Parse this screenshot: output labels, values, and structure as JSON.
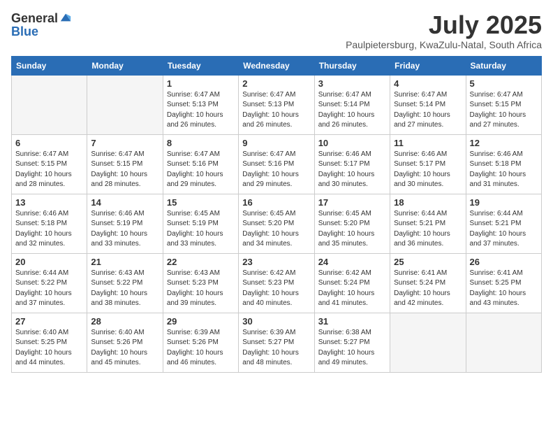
{
  "logo": {
    "general": "General",
    "blue": "Blue"
  },
  "title": "July 2025",
  "location": "Paulpietersburg, KwaZulu-Natal, South Africa",
  "weekdays": [
    "Sunday",
    "Monday",
    "Tuesday",
    "Wednesday",
    "Thursday",
    "Friday",
    "Saturday"
  ],
  "weeks": [
    [
      {
        "day": "",
        "info": ""
      },
      {
        "day": "",
        "info": ""
      },
      {
        "day": "1",
        "info": "Sunrise: 6:47 AM\nSunset: 5:13 PM\nDaylight: 10 hours and 26 minutes."
      },
      {
        "day": "2",
        "info": "Sunrise: 6:47 AM\nSunset: 5:13 PM\nDaylight: 10 hours and 26 minutes."
      },
      {
        "day": "3",
        "info": "Sunrise: 6:47 AM\nSunset: 5:14 PM\nDaylight: 10 hours and 26 minutes."
      },
      {
        "day": "4",
        "info": "Sunrise: 6:47 AM\nSunset: 5:14 PM\nDaylight: 10 hours and 27 minutes."
      },
      {
        "day": "5",
        "info": "Sunrise: 6:47 AM\nSunset: 5:15 PM\nDaylight: 10 hours and 27 minutes."
      }
    ],
    [
      {
        "day": "6",
        "info": "Sunrise: 6:47 AM\nSunset: 5:15 PM\nDaylight: 10 hours and 28 minutes."
      },
      {
        "day": "7",
        "info": "Sunrise: 6:47 AM\nSunset: 5:15 PM\nDaylight: 10 hours and 28 minutes."
      },
      {
        "day": "8",
        "info": "Sunrise: 6:47 AM\nSunset: 5:16 PM\nDaylight: 10 hours and 29 minutes."
      },
      {
        "day": "9",
        "info": "Sunrise: 6:47 AM\nSunset: 5:16 PM\nDaylight: 10 hours and 29 minutes."
      },
      {
        "day": "10",
        "info": "Sunrise: 6:46 AM\nSunset: 5:17 PM\nDaylight: 10 hours and 30 minutes."
      },
      {
        "day": "11",
        "info": "Sunrise: 6:46 AM\nSunset: 5:17 PM\nDaylight: 10 hours and 30 minutes."
      },
      {
        "day": "12",
        "info": "Sunrise: 6:46 AM\nSunset: 5:18 PM\nDaylight: 10 hours and 31 minutes."
      }
    ],
    [
      {
        "day": "13",
        "info": "Sunrise: 6:46 AM\nSunset: 5:18 PM\nDaylight: 10 hours and 32 minutes."
      },
      {
        "day": "14",
        "info": "Sunrise: 6:46 AM\nSunset: 5:19 PM\nDaylight: 10 hours and 33 minutes."
      },
      {
        "day": "15",
        "info": "Sunrise: 6:45 AM\nSunset: 5:19 PM\nDaylight: 10 hours and 33 minutes."
      },
      {
        "day": "16",
        "info": "Sunrise: 6:45 AM\nSunset: 5:20 PM\nDaylight: 10 hours and 34 minutes."
      },
      {
        "day": "17",
        "info": "Sunrise: 6:45 AM\nSunset: 5:20 PM\nDaylight: 10 hours and 35 minutes."
      },
      {
        "day": "18",
        "info": "Sunrise: 6:44 AM\nSunset: 5:21 PM\nDaylight: 10 hours and 36 minutes."
      },
      {
        "day": "19",
        "info": "Sunrise: 6:44 AM\nSunset: 5:21 PM\nDaylight: 10 hours and 37 minutes."
      }
    ],
    [
      {
        "day": "20",
        "info": "Sunrise: 6:44 AM\nSunset: 5:22 PM\nDaylight: 10 hours and 37 minutes."
      },
      {
        "day": "21",
        "info": "Sunrise: 6:43 AM\nSunset: 5:22 PM\nDaylight: 10 hours and 38 minutes."
      },
      {
        "day": "22",
        "info": "Sunrise: 6:43 AM\nSunset: 5:23 PM\nDaylight: 10 hours and 39 minutes."
      },
      {
        "day": "23",
        "info": "Sunrise: 6:42 AM\nSunset: 5:23 PM\nDaylight: 10 hours and 40 minutes."
      },
      {
        "day": "24",
        "info": "Sunrise: 6:42 AM\nSunset: 5:24 PM\nDaylight: 10 hours and 41 minutes."
      },
      {
        "day": "25",
        "info": "Sunrise: 6:41 AM\nSunset: 5:24 PM\nDaylight: 10 hours and 42 minutes."
      },
      {
        "day": "26",
        "info": "Sunrise: 6:41 AM\nSunset: 5:25 PM\nDaylight: 10 hours and 43 minutes."
      }
    ],
    [
      {
        "day": "27",
        "info": "Sunrise: 6:40 AM\nSunset: 5:25 PM\nDaylight: 10 hours and 44 minutes."
      },
      {
        "day": "28",
        "info": "Sunrise: 6:40 AM\nSunset: 5:26 PM\nDaylight: 10 hours and 45 minutes."
      },
      {
        "day": "29",
        "info": "Sunrise: 6:39 AM\nSunset: 5:26 PM\nDaylight: 10 hours and 46 minutes."
      },
      {
        "day": "30",
        "info": "Sunrise: 6:39 AM\nSunset: 5:27 PM\nDaylight: 10 hours and 48 minutes."
      },
      {
        "day": "31",
        "info": "Sunrise: 6:38 AM\nSunset: 5:27 PM\nDaylight: 10 hours and 49 minutes."
      },
      {
        "day": "",
        "info": ""
      },
      {
        "day": "",
        "info": ""
      }
    ]
  ]
}
